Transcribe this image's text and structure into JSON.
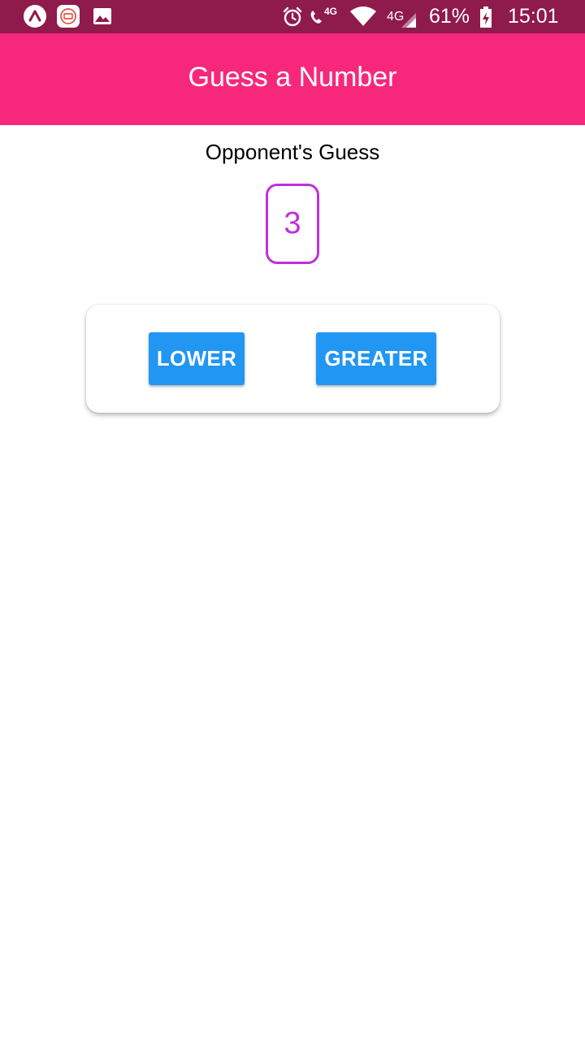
{
  "status_bar": {
    "left_icons": [
      "expo-icon",
      "mi-icon",
      "image-icon"
    ],
    "right_icons": [
      "alarm-icon",
      "call-4g-icon",
      "wifi-icon",
      "signal-4g-icon",
      "battery-charging-icon"
    ],
    "volte_label": "4G",
    "network_label": "4G",
    "battery_percent": "61%",
    "time": "15:01"
  },
  "header": {
    "title": "Guess a Number"
  },
  "main": {
    "opponent_label": "Opponent's Guess",
    "guess_value": "3",
    "lower_label": "LOWER",
    "greater_label": "GREATER"
  },
  "colors": {
    "status_bar": "#8f1a4c",
    "header": "#f7287b",
    "accent_number": "#c12fdc",
    "button": "#2196f3"
  }
}
